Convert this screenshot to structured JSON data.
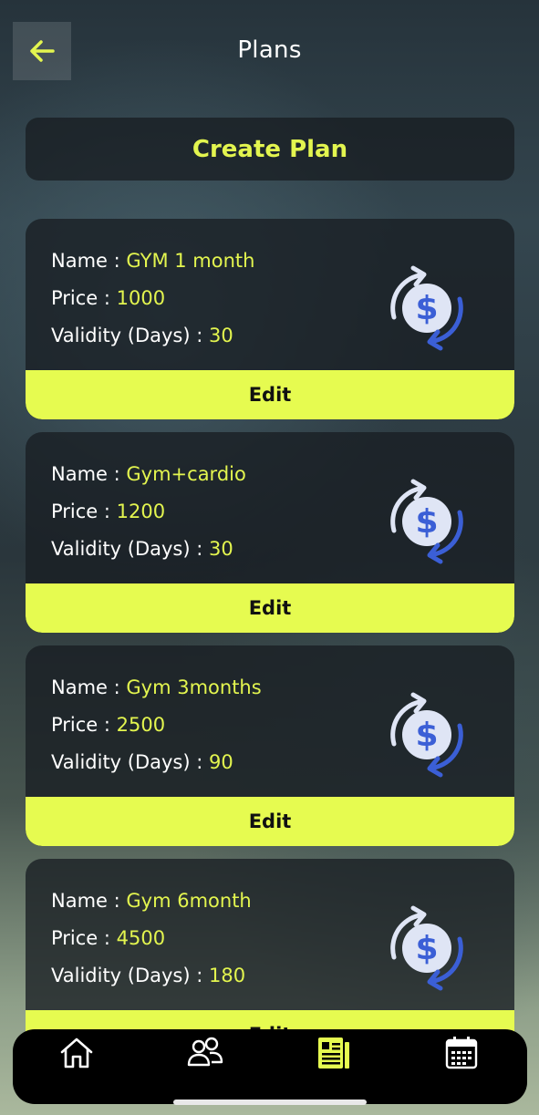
{
  "header": {
    "title": "Plans"
  },
  "create_button": {
    "label": "Create Plan"
  },
  "labels": {
    "name": "Name : ",
    "price": "Price : ",
    "validity": "Validity (Days) : "
  },
  "plans": [
    {
      "name": "GYM 1 month",
      "price": "1000",
      "validity": "30",
      "edit_label": "Edit"
    },
    {
      "name": "Gym+cardio",
      "price": "1200",
      "validity": "30",
      "edit_label": "Edit"
    },
    {
      "name": "Gym 3months",
      "price": "2500",
      "validity": "90",
      "edit_label": "Edit"
    },
    {
      "name": "Gym 6month",
      "price": "4500",
      "validity": "180",
      "edit_label": "Edit"
    }
  ],
  "nav": [
    {
      "icon": "home-icon"
    },
    {
      "icon": "users-icon"
    },
    {
      "icon": "plans-icon",
      "active": true
    },
    {
      "icon": "calendar-icon"
    }
  ],
  "colors": {
    "accent": "#e6fb50",
    "card_bg": "#1c2226",
    "dollar_blue": "#3b5fd6",
    "coin": "#dfe5f5"
  }
}
